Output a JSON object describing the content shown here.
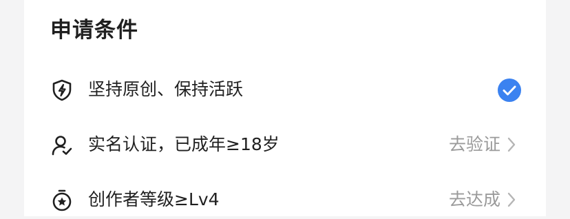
{
  "section": {
    "title": "申请条件"
  },
  "conditions": [
    {
      "label": "坚持原创、保持活跃",
      "icon": "shield-lightning-icon",
      "status": "completed"
    },
    {
      "label": "实名认证，已成年≥18岁",
      "icon": "user-check-icon",
      "action": "去验证"
    },
    {
      "label": "创作者等级≥Lv4",
      "icon": "star-medal-icon",
      "action": "去达成"
    }
  ],
  "colors": {
    "check": "#3b82f0",
    "action_text": "#9a9a9a",
    "label_text": "#1f1f1f"
  }
}
